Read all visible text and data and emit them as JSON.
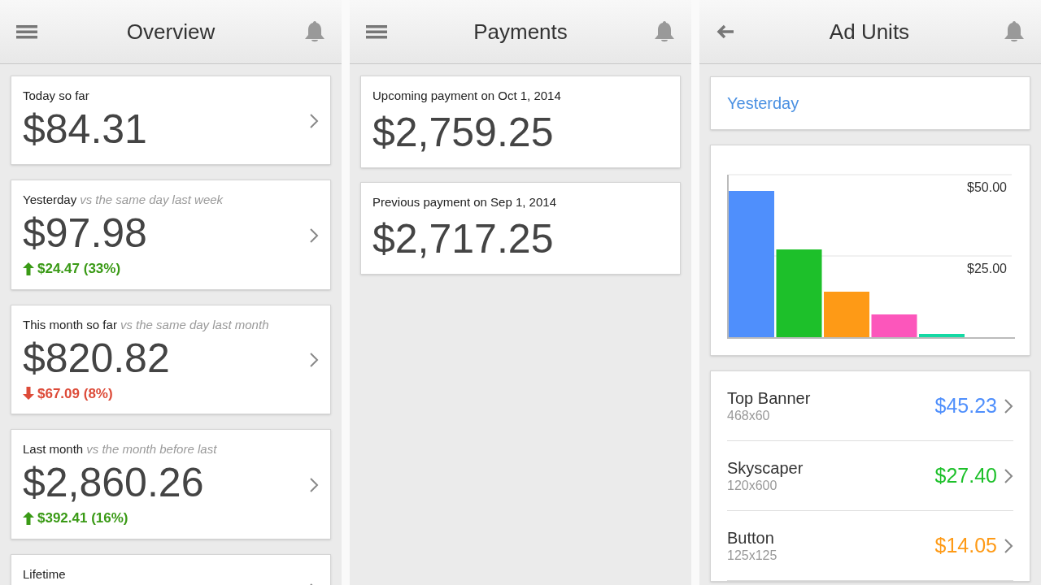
{
  "screens": [
    {
      "title": "Overview",
      "nav": {
        "kind": "menu"
      },
      "cards": [
        {
          "label": "Today so far",
          "value": "$84.31"
        },
        {
          "label": "Yesterday",
          "note": "vs the same day last week",
          "value": "$97.98",
          "change": {
            "kind": "up",
            "text": "$24.47 (33%)"
          }
        },
        {
          "label": "This month so far",
          "note": "vs the same day last month",
          "value": "$820.82",
          "change": {
            "kind": "down",
            "text": "$67.09 (8%)"
          }
        },
        {
          "label": "Last month",
          "note": "vs the month before last",
          "value": "$2,860.26",
          "change": {
            "kind": "up",
            "text": "$392.41 (16%)"
          }
        },
        {
          "label": "Lifetime"
        }
      ]
    },
    {
      "title": "Payments",
      "nav": {
        "kind": "menu"
      },
      "payments": [
        {
          "label": "Upcoming payment on Oct 1, 2014",
          "value": "$2,759.25"
        },
        {
          "label": "Previous payment on Sep 1, 2014",
          "value": "$2,717.25"
        }
      ]
    },
    {
      "title": "Ad Units",
      "nav": {
        "kind": "back"
      },
      "range": "Yesterday",
      "chart_data": {
        "type": "bar",
        "values": [
          45,
          27,
          14,
          7,
          1
        ],
        "colors": [
          "#4f8ffc",
          "#1dc02a",
          "#fe9a16",
          "#fc56bb",
          "#14d9a4"
        ],
        "ylim": [
          0,
          50
        ],
        "yticks": [
          {
            "value": 25,
            "label": "$25.00"
          },
          {
            "value": 50,
            "label": "$50.00"
          }
        ]
      },
      "units": [
        {
          "name": "Top Banner",
          "size": "468x60",
          "amount": "$45.23",
          "color": "#4f8ffc"
        },
        {
          "name": "Skyscaper",
          "size": "120x600",
          "amount": "$27.40",
          "color": "#1dc02a"
        },
        {
          "name": "Button",
          "size": "125x125",
          "amount": "$14.05",
          "color": "#fe9a16"
        }
      ]
    }
  ]
}
